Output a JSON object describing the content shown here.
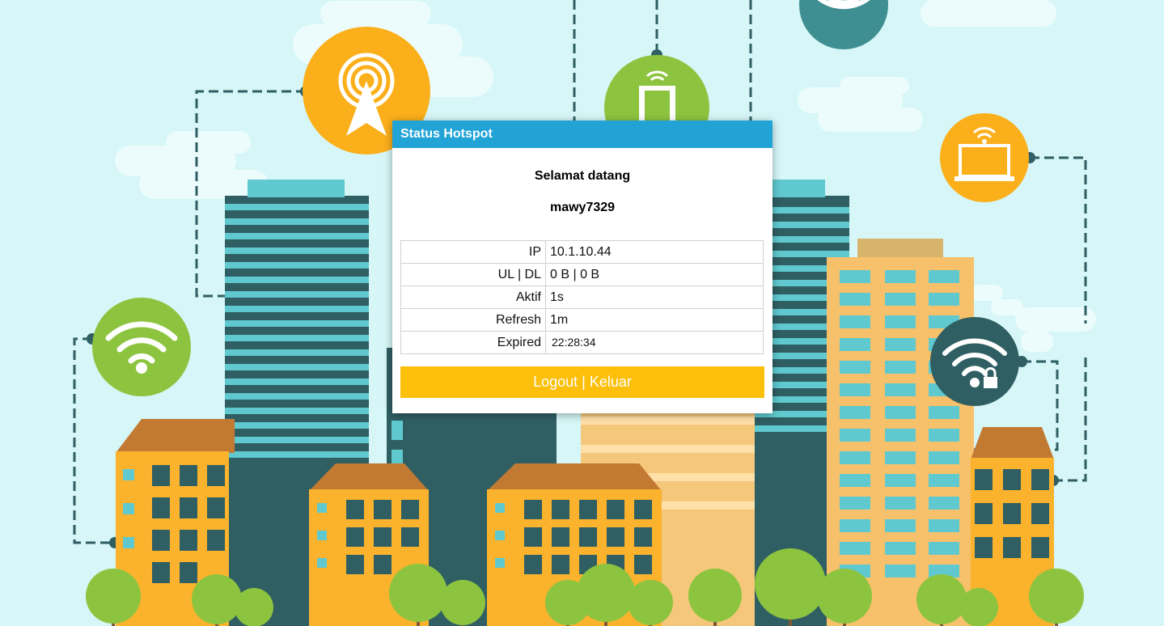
{
  "colors": {
    "header": "#21a3d6",
    "button": "#fcbf0a",
    "background": "#d6f6f7"
  },
  "panel": {
    "title": "Status Hotspot",
    "welcome": "Selamat datang",
    "username": "mawy7329",
    "rows": [
      {
        "label": "IP",
        "value": "10.1.10.44"
      },
      {
        "label": "UL | DL",
        "value": "0 B | 0 B"
      },
      {
        "label": "Aktif",
        "value": "1s"
      },
      {
        "label": "Refresh",
        "value": "1m"
      },
      {
        "label": "Expired",
        "value": "22:28:34"
      }
    ],
    "logout_label": "Logout | Keluar"
  },
  "background_icons": [
    "antenna-icon",
    "phone-wifi-icon",
    "wifi-icon",
    "laptop-wifi-icon",
    "wifi-lock-icon"
  ]
}
